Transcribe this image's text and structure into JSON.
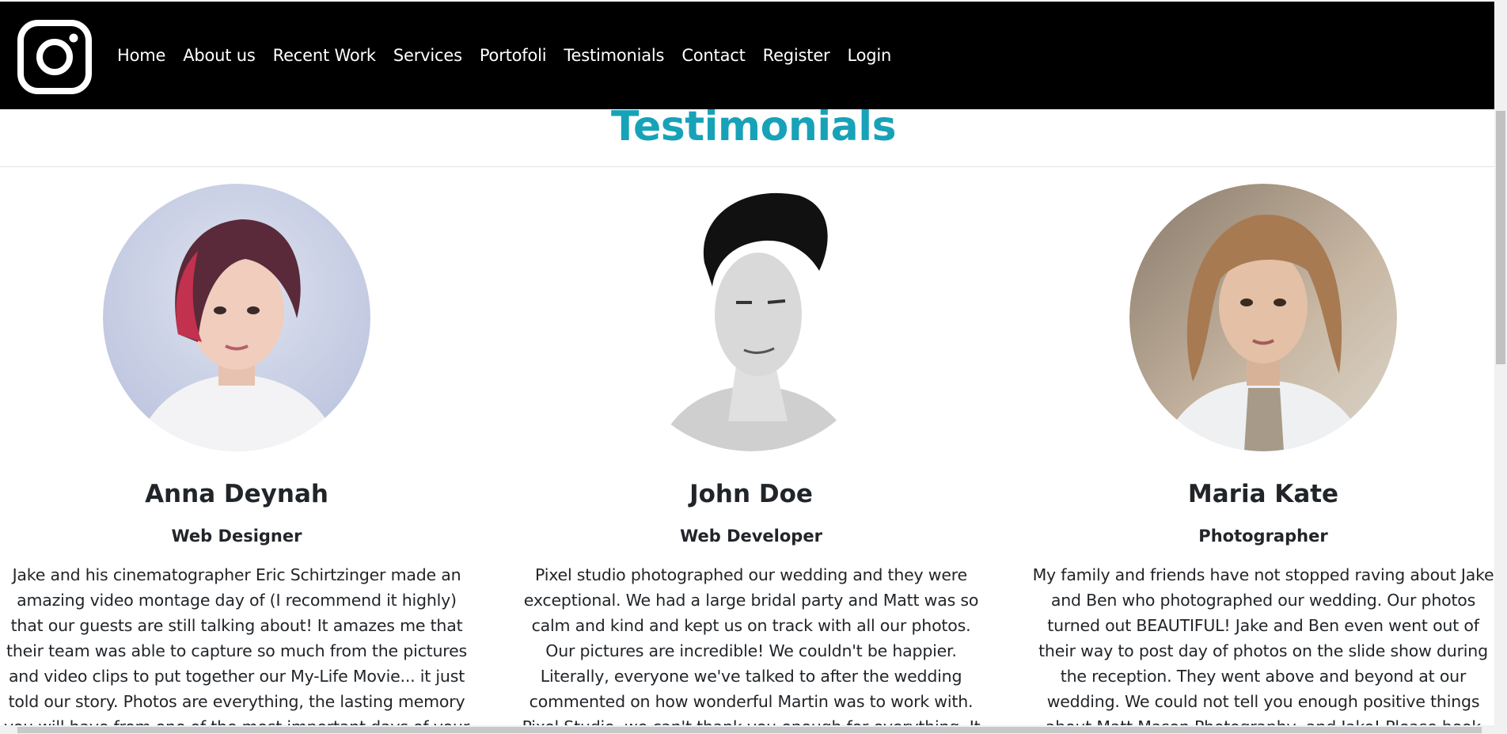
{
  "nav": {
    "logo": "instagram-icon",
    "links": [
      "Home",
      "About us",
      "Recent Work",
      "Services",
      "Portofoli",
      "Testimonials",
      "Contact",
      "Register",
      "Login"
    ]
  },
  "section": {
    "title": "Testimonials"
  },
  "testimonials": [
    {
      "name": "Anna Deynah",
      "role": "Web Designer",
      "quote": "Jake and his cinematographer Eric Schirtzinger made an amazing video montage day of (I recommend it highly) that our guests are still talking about! It amazes me that their team was able to capture so much from the pictures and video clips to put together our My-Life Movie... it just told our story. Photos are everything, the lasting memory you will have from one of the most important days of your life. I strongly recommend this"
    },
    {
      "name": "John Doe",
      "role": "Web Developer",
      "quote": "Pixel studio photographed our wedding and they were exceptional. We had a large bridal party and Matt was so calm and kind and kept us on track with all our photos. Our pictures are incredible! We couldn't be happier. Literally, everyone we've talked to after the wedding commented on how wonderful Martin was to work with. Pixel Studio, we can't thank you enough for everything. It was a pleasure working with you and"
    },
    {
      "name": "Maria Kate",
      "role": "Photographer",
      "quote": "My family and friends have not stopped raving about Jake and Ben who photographed our wedding. Our photos turned out BEAUTIFUL! Jake and Ben even went out of their way to post day of photos on the slide show during the reception. They went above and beyond at our wedding. We could not tell you enough positive things about Matt Mason Photography, and Jake! Please book with them and you will not be"
    }
  ],
  "colors": {
    "accent": "#17a2b8",
    "navbar": "#000000",
    "text": "#212529"
  }
}
